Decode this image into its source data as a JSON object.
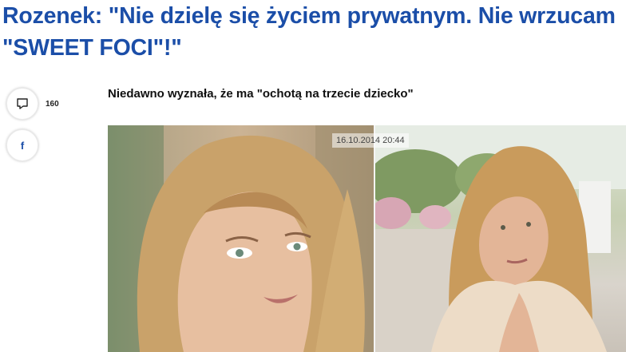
{
  "article": {
    "title": "Rozenek: \"Nie dzielę się życiem prywatnym. Nie wrzucam \"SWEET FOCI\"!\"",
    "lead": "Niedawno wyznała, że ma \"ochotą na trzecie dziecko\""
  },
  "share": {
    "comments_icon": "comment-icon",
    "comments_count": "160",
    "facebook_icon": "facebook-icon",
    "facebook_glyph": "f"
  },
  "photo": {
    "timestamp": "16.10.2014 20:44"
  },
  "colors": {
    "headline": "#1b4ea8",
    "facebook": "#1b4ea8",
    "text": "#111111",
    "background": "#ffffff"
  }
}
